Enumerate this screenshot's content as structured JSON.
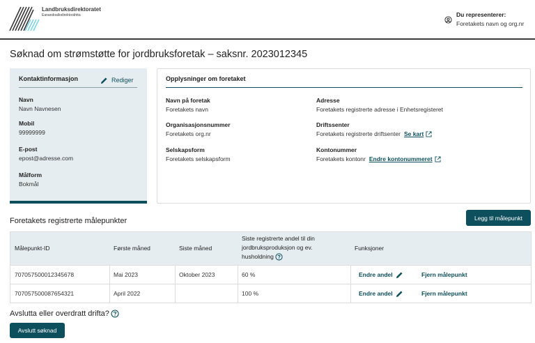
{
  "header": {
    "logo_title": "Landbruksdirektoratet",
    "logo_subtitle": "Eanandoallodirektoráhtta",
    "represent_label": "Du representerer:",
    "represent_value": "Foretakets navn og org.nr"
  },
  "page_title": "Søknad om strømstøtte for jordbruksforetak – saksnr. 2023012345",
  "contact": {
    "heading": "Kontaktinformasjon",
    "edit_label": "Rediger",
    "fields": [
      {
        "label": "Navn",
        "value": "Navn Navnesen"
      },
      {
        "label": "Mobil",
        "value": "99999999"
      },
      {
        "label": "E-post",
        "value": "epost@adresse.com"
      },
      {
        "label": "Målform",
        "value": "Bokmål"
      }
    ]
  },
  "company": {
    "heading": "Opplysninger om foretaket",
    "left": [
      {
        "label": "Navn på foretak",
        "value": "Foretakets navn"
      },
      {
        "label": "Organisasjonsnummer",
        "value": "Foretakets org.nr"
      },
      {
        "label": "Selskapsform",
        "value": "Foretakets selskapsform"
      }
    ],
    "right": [
      {
        "label": "Adresse",
        "value": "Foretakets registrerte adresse i Enhetsregisteret"
      },
      {
        "label": "Driftssenter",
        "value": "Foretakets registrerte driftsenter",
        "link": "Se kart"
      },
      {
        "label": "Kontonummer",
        "value": "Foretakets kontonr",
        "link": "Endre kontonummeret"
      }
    ]
  },
  "meters": {
    "title": "Foretakets registrerte målepunkter",
    "add_label": "Legg til målepunkt",
    "headers": {
      "id": "Målepunkt-ID",
      "first": "Første måned",
      "last": "Siste måned",
      "share_line1": "Siste registrerte andel til din",
      "share_line2": "jordbruksproduksjon og ev.",
      "share_line3": "husholdning",
      "functions": "Funksjoner"
    },
    "rows": [
      {
        "id": "707057500012345678",
        "first": "Mai 2023",
        "last": "Oktober 2023",
        "share": "60 %",
        "edit": "Endre andel",
        "remove": "Fjern målepunkt"
      },
      {
        "id": "707057500087654321",
        "first": "April 2022",
        "last": "",
        "share": "100 %",
        "edit": "Endre andel",
        "remove": "Fjern målepunkt"
      }
    ]
  },
  "footer": {
    "question": "Avslutta eller overdratt drifta?",
    "finish_label": "Avslutt søknad"
  },
  "colors": {
    "brand": "#0d4f5c",
    "panel": "#e6edf0",
    "logo_cyan": "#7fd3e3"
  }
}
